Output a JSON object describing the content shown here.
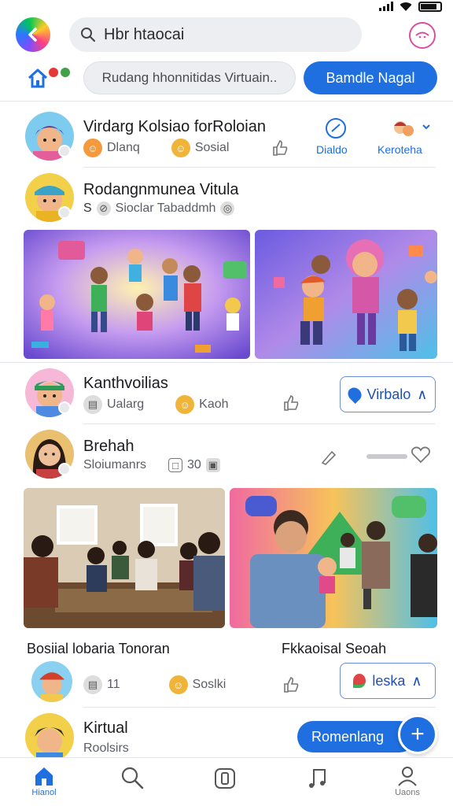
{
  "colors": {
    "accent": "#1f6fe0",
    "chat_ring": "#d94fa0",
    "divider": "#e3e5ea"
  },
  "header": {
    "search_text": "Hbr htaocai",
    "pill_input_text": "Rudang hhonnitidas Virtuain..",
    "pill_button": "Bamdle Nagal"
  },
  "feed": [
    {
      "name": "Virdarg Kolsiao forRoloian",
      "meta1": "Dlanq",
      "meta2": "Sosial",
      "action1": "Dialdo",
      "action2": "Keroteha"
    },
    {
      "name": "Rodangnmunea Vitula",
      "meta": "Sioclar Tabaddmh"
    },
    {
      "name": "Kanthvoilias",
      "meta1": "Ualarg",
      "meta2": "Kaoh",
      "button": "Virbalo"
    },
    {
      "name": "Brehah",
      "meta": "Sloiumanrs",
      "meta_num": "30"
    },
    {
      "caption_left": "Bosiial lobaria Tonoran",
      "caption_right": "Fkkaoisal Seoah",
      "meta1": "11",
      "meta2": "Soslki",
      "button": "leska"
    },
    {
      "name": "Kirtual",
      "meta": "Roolsirs",
      "button": "Romenlang"
    }
  ],
  "bottom_nav": [
    {
      "label": "Hianol",
      "icon": "home-icon"
    },
    {
      "label": "",
      "icon": "search-icon"
    },
    {
      "label": "",
      "icon": "phone-icon"
    },
    {
      "label": "",
      "icon": "music-icon"
    },
    {
      "label": "Uaons",
      "icon": "profile-icon"
    }
  ]
}
